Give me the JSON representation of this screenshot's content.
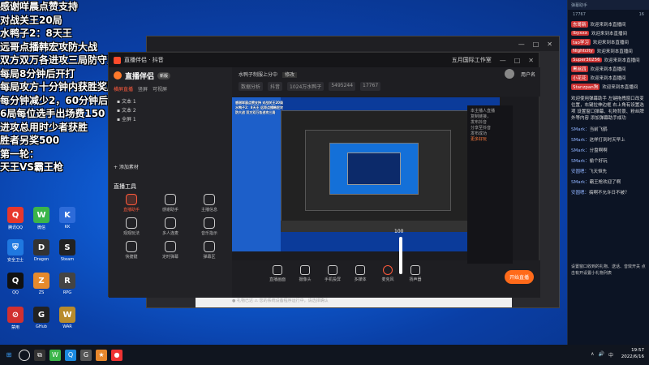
{
  "overlay_lines": [
    "感谢咩晨点赞支持",
    "对战关王20局",
    "水鸭子2：8天王",
    "远哥点播韩宏攻防大战",
    "双方双万各进攻三局防守三局",
    "每局8分钟后开打",
    "每局攻方十分钟内获胜奖励100",
    "每分钟减少2，60分钟后算平局",
    "6局每位选手出场费150",
    "进攻总用时少者获胜",
    "胜者另奖500",
    "第一轮：",
    "天王VS霸王枪"
  ],
  "desktop_icons": [
    {
      "label": "腾讯QQ",
      "glyph": "Q",
      "color": "#e7372c"
    },
    {
      "label": "微信",
      "glyph": "W",
      "color": "#3bb54a"
    },
    {
      "label": "KK",
      "glyph": "K",
      "color": "#2d6bd9"
    },
    {
      "label": "安全卫士",
      "glyph": "⛨",
      "color": "#1f78e0"
    },
    {
      "label": "Dragon",
      "glyph": "D",
      "color": "#333"
    },
    {
      "label": "Steam",
      "glyph": "S",
      "color": "#222"
    },
    {
      "label": "QQ",
      "glyph": "Q",
      "color": "#111"
    },
    {
      "label": "ZS",
      "glyph": "Z",
      "color": "#e78a2c"
    },
    {
      "label": "RPG",
      "glyph": "R",
      "color": "#444"
    },
    {
      "label": "禁用",
      "glyph": "⊘",
      "color": "#d13030"
    },
    {
      "label": "GHub",
      "glyph": "G",
      "color": "#222"
    },
    {
      "label": "WAR",
      "glyph": "W",
      "color": "#b88b2c"
    }
  ],
  "back_window": {
    "controls": [
      "—",
      "□",
      "✕"
    ]
  },
  "main_window": {
    "title": "直播伴侣 · 抖音",
    "title_right": "五月国际工作室",
    "controls": [
      "—",
      "□",
      "✕"
    ]
  },
  "left_panel": {
    "brand": "直播伴侣",
    "version": "新版",
    "scene_tabs": [
      "横屏直播",
      "竖屏",
      "可视屏"
    ],
    "scenes": [
      "▪ 文本 1",
      "▪ 文本 2",
      "▪ 全屏 1"
    ],
    "add_source": "+ 添加素材",
    "tools_title": "直播工具",
    "tools": [
      {
        "label": "直播助手",
        "active": true
      },
      {
        "label": "感谢助手",
        "active": false
      },
      {
        "label": "主播信息",
        "active": false
      },
      {
        "label": "观观玩法",
        "active": false
      },
      {
        "label": "多人连麦",
        "active": false
      },
      {
        "label": "音乐指示",
        "active": false
      },
      {
        "label": "快捷键",
        "active": false
      },
      {
        "label": "定时弹幕",
        "active": false
      },
      {
        "label": "弹幕区",
        "active": false
      }
    ]
  },
  "top_bar": {
    "title": "水鸭子制服上分中",
    "tag": "修改",
    "meta": [
      "数据分析",
      "抖音",
      "1024万水鸭子",
      "5495244",
      "17767"
    ],
    "user": "用户名"
  },
  "preview": {
    "text": "感谢咩晨点赞支持 对战关王20局 水鸭子2：8天王 远哥点播韩宏攻防大战 双方双万各进攻三局"
  },
  "right_side": {
    "lines": [
      "本主播人直播",
      "复制链接，",
      "发布抖音",
      "分享至抖音",
      "发布成功"
    ],
    "highlight": "更多好玩"
  },
  "bottom_bar": {
    "buttons": [
      "直播画面",
      "摄像头",
      "手机投屏",
      "多媒体",
      "麦克风",
      "扬声器"
    ],
    "go_live": "开始直播"
  },
  "volume": {
    "value": 100,
    "label": "100"
  },
  "status_line": "● 礼物已达  ⚠ 您的系统设备程序运行中，请选择确认",
  "chat_panel": {
    "title": "弹幕助手",
    "stats": [
      "17767",
      "16"
    ],
    "welcome_rows": [
      {
        "name": "东哥新",
        "text": "欢迎来到本直播间"
      },
      {
        "name": "lbyxxx",
        "text": "欢迎来到本直播间"
      },
      {
        "name": "tao学习",
        "text": "欢迎来到本直播间"
      },
      {
        "name": "Nightcity",
        "text": "欢迎来到本直播间"
      },
      {
        "name": "Super30256",
        "text": "欢迎来到本直播间"
      },
      {
        "name": "黑丝四",
        "text": "欢迎来到本直播间"
      },
      {
        "name": "小花花",
        "text": "欢迎来到本直播间"
      },
      {
        "name": "Stanzpan狗",
        "text": "欢迎来到本直播间"
      }
    ],
    "system_msg": "欢迎使用弹幕助手 左键拖拽窗口改变位置，右键拉伸边框 右上角有设置选项 设置窗口弹幕、礼物背景、粉丝牌外等内容 添加弹幕助手成功",
    "messages": [
      {
        "name": "SMark：",
        "text": "当前飞鹤"
      },
      {
        "name": "SMark：",
        "text": "这样打到时天早上"
      },
      {
        "name": "SMark：",
        "text": "分盘啊啊"
      },
      {
        "name": "SMark：",
        "text": "偷个好玩"
      },
      {
        "name": "安圆嗯：",
        "text": "飞天恒先"
      },
      {
        "name": "SMark：",
        "text": "霸王枪欢迎了啊"
      },
      {
        "name": "安圆嗯：",
        "text": "搞啊不允许日不被？"
      }
    ],
    "footer": "设置窗口收到的礼物、送话、音效开关 点击有开设置小礼物列表"
  },
  "taskbar": {
    "time": "19:57",
    "date": "2022/6/16",
    "tray": [
      "∧",
      "🔊",
      "中"
    ],
    "apps": [
      {
        "glyph": "⊞",
        "color": "#1f78e0"
      },
      {
        "glyph": "⧉",
        "color": "#333"
      },
      {
        "glyph": "W",
        "color": "#3bb54a"
      },
      {
        "glyph": "Q",
        "color": "#1b8ae0"
      },
      {
        "glyph": "G",
        "color": "#555"
      },
      {
        "glyph": "★",
        "color": "#e7872c"
      },
      {
        "glyph": "●",
        "color": "#e33"
      }
    ]
  }
}
